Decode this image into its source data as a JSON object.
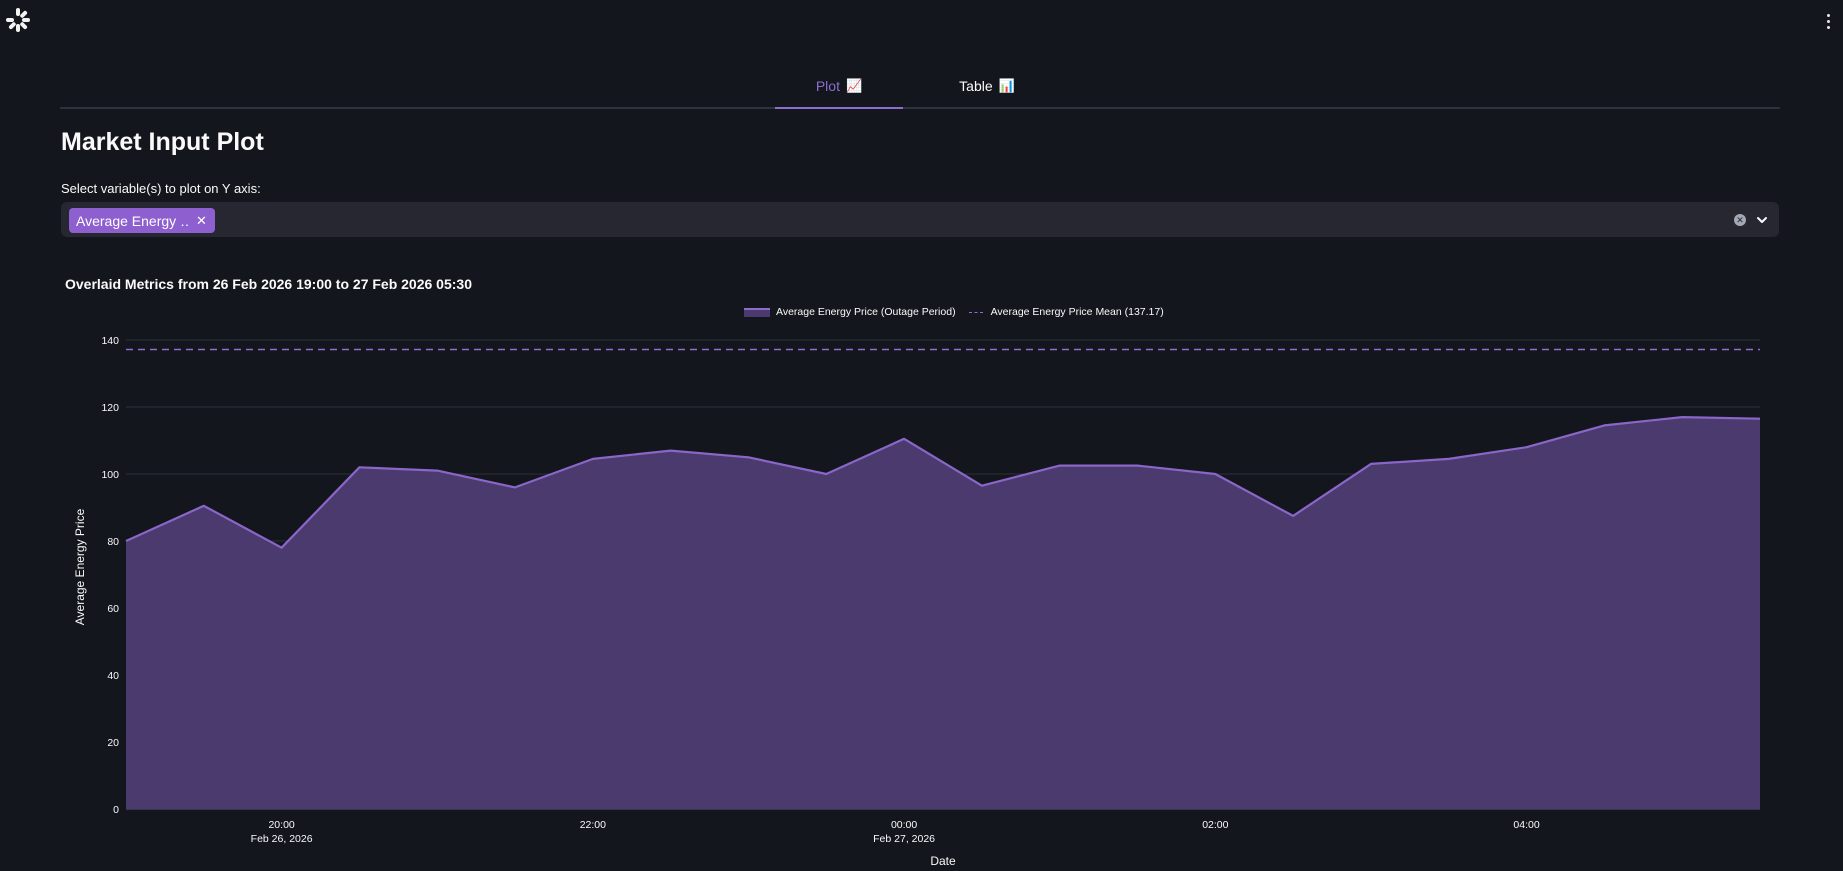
{
  "app": {
    "logo_icon": "streamlit-pinwheel-icon",
    "menu_icon": "vertical-ellipsis-icon"
  },
  "tabs": [
    {
      "label": "Plot",
      "emoji": "📈",
      "active": true
    },
    {
      "label": "Table",
      "emoji": "📊",
      "active": false
    }
  ],
  "page_title": "Market Input Plot",
  "selector": {
    "label": "Select variable(s) to plot on Y axis:",
    "selected": [
      "Average Energy …"
    ],
    "clear_icon": "clear-circle-icon",
    "dropdown_icon": "chevron-down-icon"
  },
  "colors": {
    "background": "#13161c",
    "accent": "#8d6dcf",
    "chip": "#8d5fcf",
    "area_fill": "#4a3a6e"
  },
  "chart_data": {
    "type": "area",
    "title": "Overlaid Metrics from 26 Feb 2026 19:00 to 27 Feb 2026 05:30",
    "xlabel": "Date",
    "ylabel": "Average Energy Price",
    "ylim": [
      0,
      140
    ],
    "yticks": [
      0,
      20,
      40,
      60,
      80,
      100,
      120,
      140
    ],
    "xlim": [
      "2026-02-26 19:00",
      "2026-02-27 05:30"
    ],
    "xticks": [
      {
        "time": "2026-02-26 20:00",
        "label": "20:00",
        "sublabel": "Feb 26, 2026"
      },
      {
        "time": "2026-02-26 22:00",
        "label": "22:00",
        "sublabel": ""
      },
      {
        "time": "2026-02-27 00:00",
        "label": "00:00",
        "sublabel": "Feb 27, 2026"
      },
      {
        "time": "2026-02-27 02:00",
        "label": "02:00",
        "sublabel": ""
      },
      {
        "time": "2026-02-27 04:00",
        "label": "04:00",
        "sublabel": ""
      }
    ],
    "grid": true,
    "legend_position": "top-center",
    "series": [
      {
        "name": "Average Energy Price (Outage Period)",
        "style": "area",
        "x": [
          "2026-02-26 19:00",
          "2026-02-26 19:30",
          "2026-02-26 20:00",
          "2026-02-26 20:30",
          "2026-02-26 21:00",
          "2026-02-26 21:30",
          "2026-02-26 22:00",
          "2026-02-26 22:30",
          "2026-02-26 23:00",
          "2026-02-26 23:30",
          "2026-02-27 00:00",
          "2026-02-27 00:30",
          "2026-02-27 01:00",
          "2026-02-27 01:30",
          "2026-02-27 02:00",
          "2026-02-27 02:30",
          "2026-02-27 03:00",
          "2026-02-27 03:30",
          "2026-02-27 04:00",
          "2026-02-27 04:30",
          "2026-02-27 05:00",
          "2026-02-27 05:30"
        ],
        "y": [
          80,
          90.5,
          78,
          102,
          101,
          96,
          104.5,
          107,
          105,
          100,
          110.5,
          96.5,
          102.5,
          102.5,
          100,
          87.5,
          103,
          104.5,
          108,
          114.5,
          117,
          116.5
        ]
      },
      {
        "name": "Average Energy Price Mean (137.17)",
        "style": "dashed-line",
        "value": 137.17
      }
    ]
  }
}
